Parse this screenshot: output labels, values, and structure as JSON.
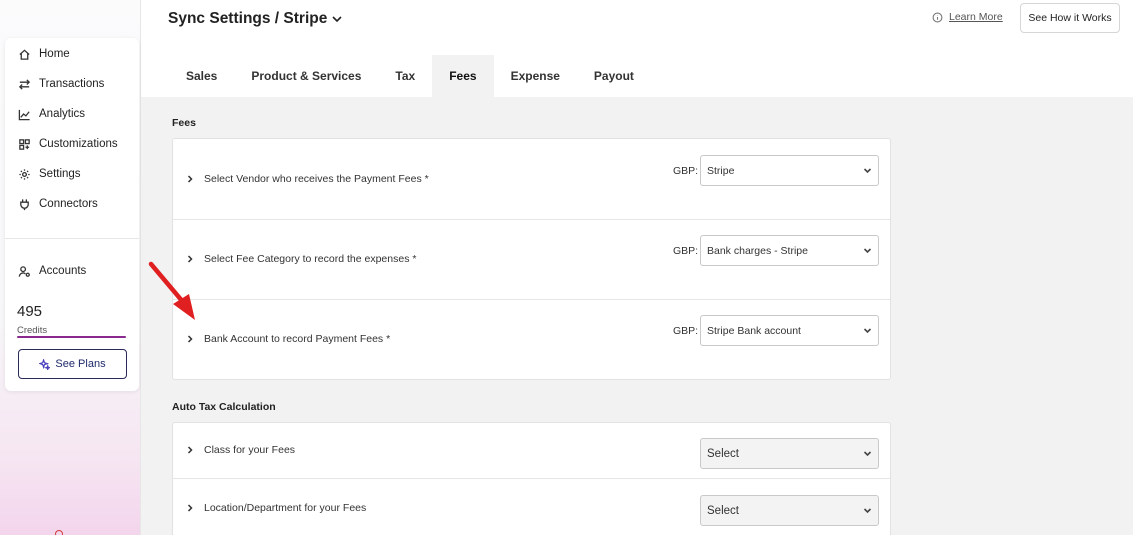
{
  "header": {
    "title": "Sync Settings / Stripe",
    "learn_more": "Learn More",
    "how_it_works": "See How it Works"
  },
  "sidebar": {
    "items": [
      {
        "label": "Home",
        "icon": "home-icon"
      },
      {
        "label": "Transactions",
        "icon": "transfer-arrows-icon"
      },
      {
        "label": "Analytics",
        "icon": "line-chart-icon"
      },
      {
        "label": "Customizations",
        "icon": "grid-icon"
      },
      {
        "label": "Settings",
        "icon": "gear-icon"
      },
      {
        "label": "Connectors",
        "icon": "plug-icon"
      }
    ],
    "accounts": {
      "label": "Accounts",
      "icon": "user-gear-icon"
    },
    "credits": {
      "value": "495",
      "label": "Credits"
    },
    "see_plans": "See Plans"
  },
  "tabs": [
    {
      "label": "Sales",
      "active": false
    },
    {
      "label": "Product & Services",
      "active": false
    },
    {
      "label": "Tax",
      "active": false
    },
    {
      "label": "Fees",
      "active": true
    },
    {
      "label": "Expense",
      "active": false
    },
    {
      "label": "Payout",
      "active": false
    }
  ],
  "fees": {
    "title": "Fees",
    "rows": [
      {
        "label": "Select Vendor who receives the Payment Fees *",
        "currency": "GBP:",
        "value": "Stripe"
      },
      {
        "label": "Select Fee Category to record the expenses *",
        "currency": "GBP:",
        "value": "Bank charges - Stripe"
      },
      {
        "label": "Bank Account to record Payment Fees *",
        "currency": "GBP:",
        "value": "Stripe Bank account"
      }
    ]
  },
  "auto_tax": {
    "title": "Auto Tax Calculation",
    "rows": [
      {
        "label": "Class for your Fees",
        "value": "Select"
      },
      {
        "label": "Location/Department for your Fees",
        "value": "Select"
      }
    ]
  },
  "colors": {
    "accent": "#8a2a8e",
    "annotation_arrow": "#e02020",
    "content_bg": "#f2f2f3"
  }
}
